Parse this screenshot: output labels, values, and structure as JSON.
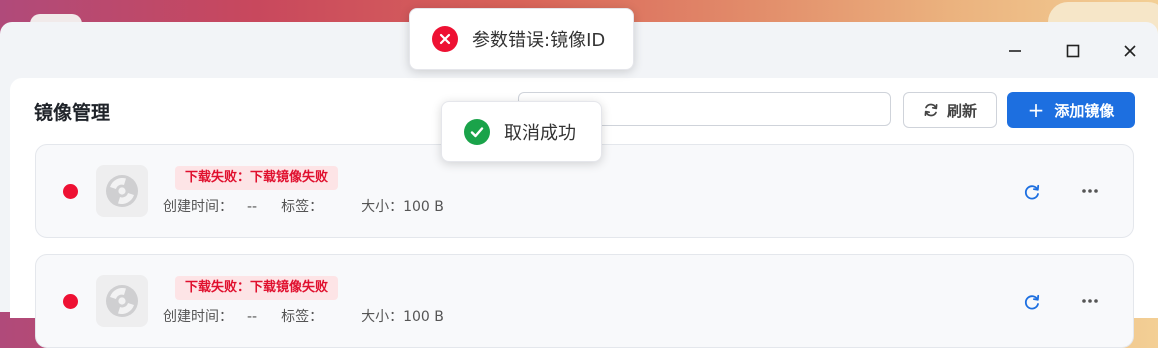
{
  "window": {
    "controls": [
      "minimize",
      "maximize",
      "close"
    ]
  },
  "header": {
    "title": "镜像管理",
    "search_value": "",
    "refresh_label": "刷新",
    "add_label": "添加镜像",
    "add_icon": "+"
  },
  "images": [
    {
      "status": "error",
      "status_text": "下载失败：下载镜像失败",
      "created_label": "创建时间：",
      "created_value": "--",
      "tags_label": "标签：",
      "tags_value": "",
      "size_label": "大小：",
      "size_value": "100 B"
    },
    {
      "status": "error",
      "status_text": "下载失败：下载镜像失败",
      "created_label": "创建时间：",
      "created_value": "--",
      "tags_label": "标签：",
      "tags_value": "",
      "size_label": "大小：",
      "size_value": "100 B"
    }
  ],
  "toasts": {
    "error": "参数错误:镜像ID",
    "success": "取消成功"
  },
  "colors": {
    "accent": "#1d6fe0",
    "error": "#ee1133",
    "success": "#1aa34a",
    "error_badge_bg": "#fde4e6"
  },
  "icons": {
    "refresh": "refresh-icon",
    "plus": "plus-icon",
    "more": "more-icon",
    "disk": "disk-icon"
  }
}
